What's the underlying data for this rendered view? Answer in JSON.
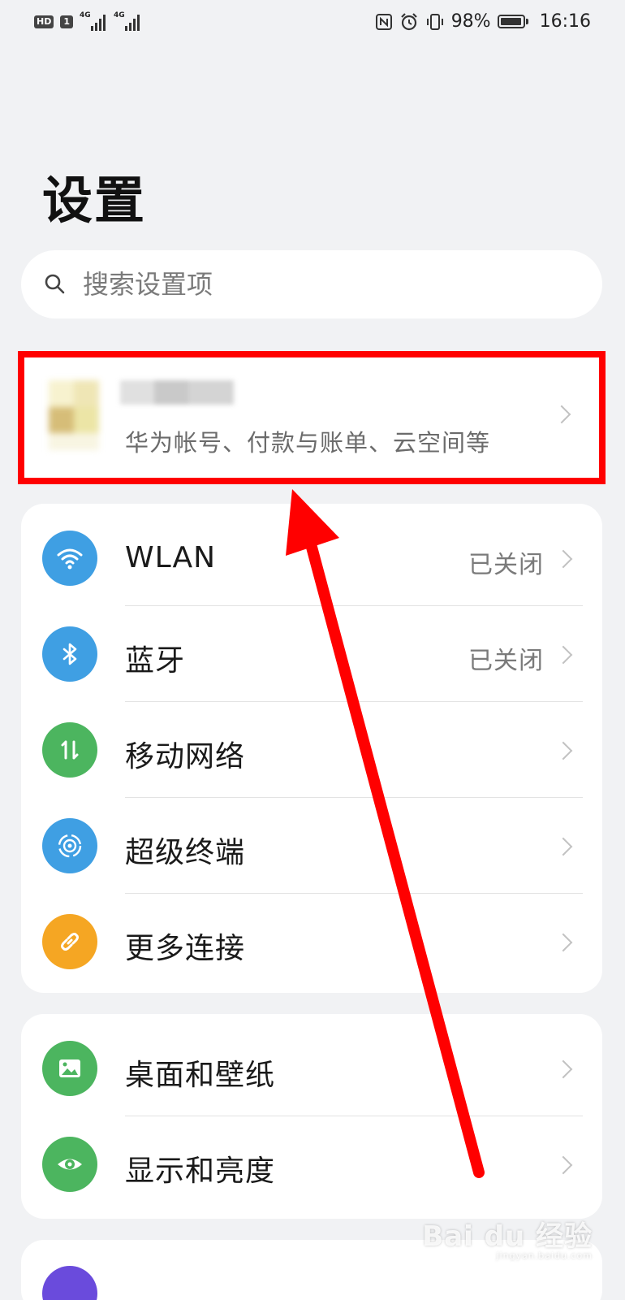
{
  "status_bar": {
    "left_badges": [
      "HD",
      "1"
    ],
    "signal_tags": [
      "4G",
      "4G"
    ],
    "battery_percent": "98%",
    "battery_level": 0.98,
    "time": "16:16",
    "icons": [
      "nfc-icon",
      "alarm-icon",
      "vibrate-icon"
    ]
  },
  "title": "设置",
  "search": {
    "placeholder": "搜索设置项"
  },
  "account": {
    "subtitle": "华为帐号、付款与账单、云空间等"
  },
  "groups": [
    {
      "items": [
        {
          "label": "WLAN",
          "value": "已关闭",
          "icon": "wifi-icon",
          "color": "#3f9fe3"
        },
        {
          "label": "蓝牙",
          "value": "已关闭",
          "icon": "bluetooth-icon",
          "color": "#3f9fe3"
        },
        {
          "label": "移动网络",
          "value": "",
          "icon": "mobile-data-icon",
          "color": "#4cb55f"
        },
        {
          "label": "超级终端",
          "value": "",
          "icon": "super-device-icon",
          "color": "#3f9fe3"
        },
        {
          "label": "更多连接",
          "value": "",
          "icon": "link-icon",
          "color": "#f5a623"
        }
      ]
    },
    {
      "items": [
        {
          "label": "桌面和壁纸",
          "value": "",
          "icon": "wallpaper-icon",
          "color": "#4cb55f"
        },
        {
          "label": "显示和亮度",
          "value": "",
          "icon": "eye-icon",
          "color": "#4cb55f"
        }
      ]
    }
  ],
  "annotation": {
    "highlight_color": "#ff0000"
  },
  "watermark": {
    "brand": "Bai du 经验",
    "url": "jingyan.baidu.com"
  }
}
